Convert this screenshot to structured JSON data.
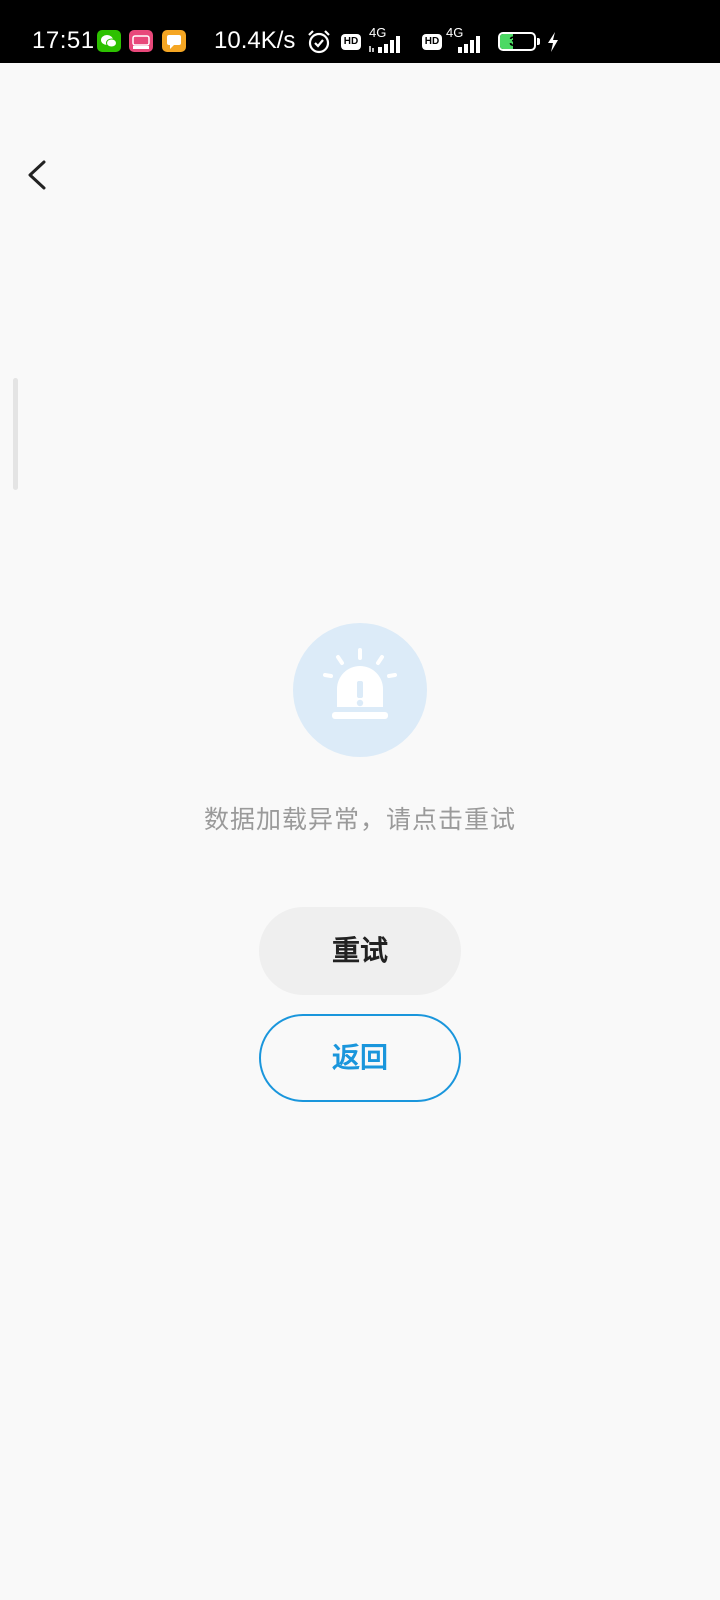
{
  "status_bar": {
    "time": "17:51",
    "network_speed": "10.4K/s",
    "battery_level": "39",
    "battery_fraction": 0.39,
    "sim1_label": "4G",
    "sim2_label": "4G",
    "hd1_label": "HD",
    "hd2_label": "HD",
    "notification_icons": [
      "wechat-icon",
      "app-icon",
      "message-icon"
    ],
    "status_icons": [
      "alarm-icon",
      "hd-icon",
      "signal-icon",
      "hd-icon",
      "signal-icon",
      "battery-icon",
      "charging-icon"
    ],
    "colors": {
      "wechat": "#2dc100",
      "app": "#e8487a",
      "message": "#f5a623",
      "battery_fill": "#4cd964"
    }
  },
  "nav": {
    "back_icon": "chevron-left-icon"
  },
  "error": {
    "icon": "siren-alarm-icon",
    "message": "数据加载异常，请点击重试"
  },
  "actions": {
    "retry_label": "重试",
    "return_label": "返回"
  },
  "colors": {
    "background": "#f9f9f9",
    "accent": "#1a96dc",
    "icon_circle": "#dcebf8",
    "message_text": "#9a9a9a"
  }
}
